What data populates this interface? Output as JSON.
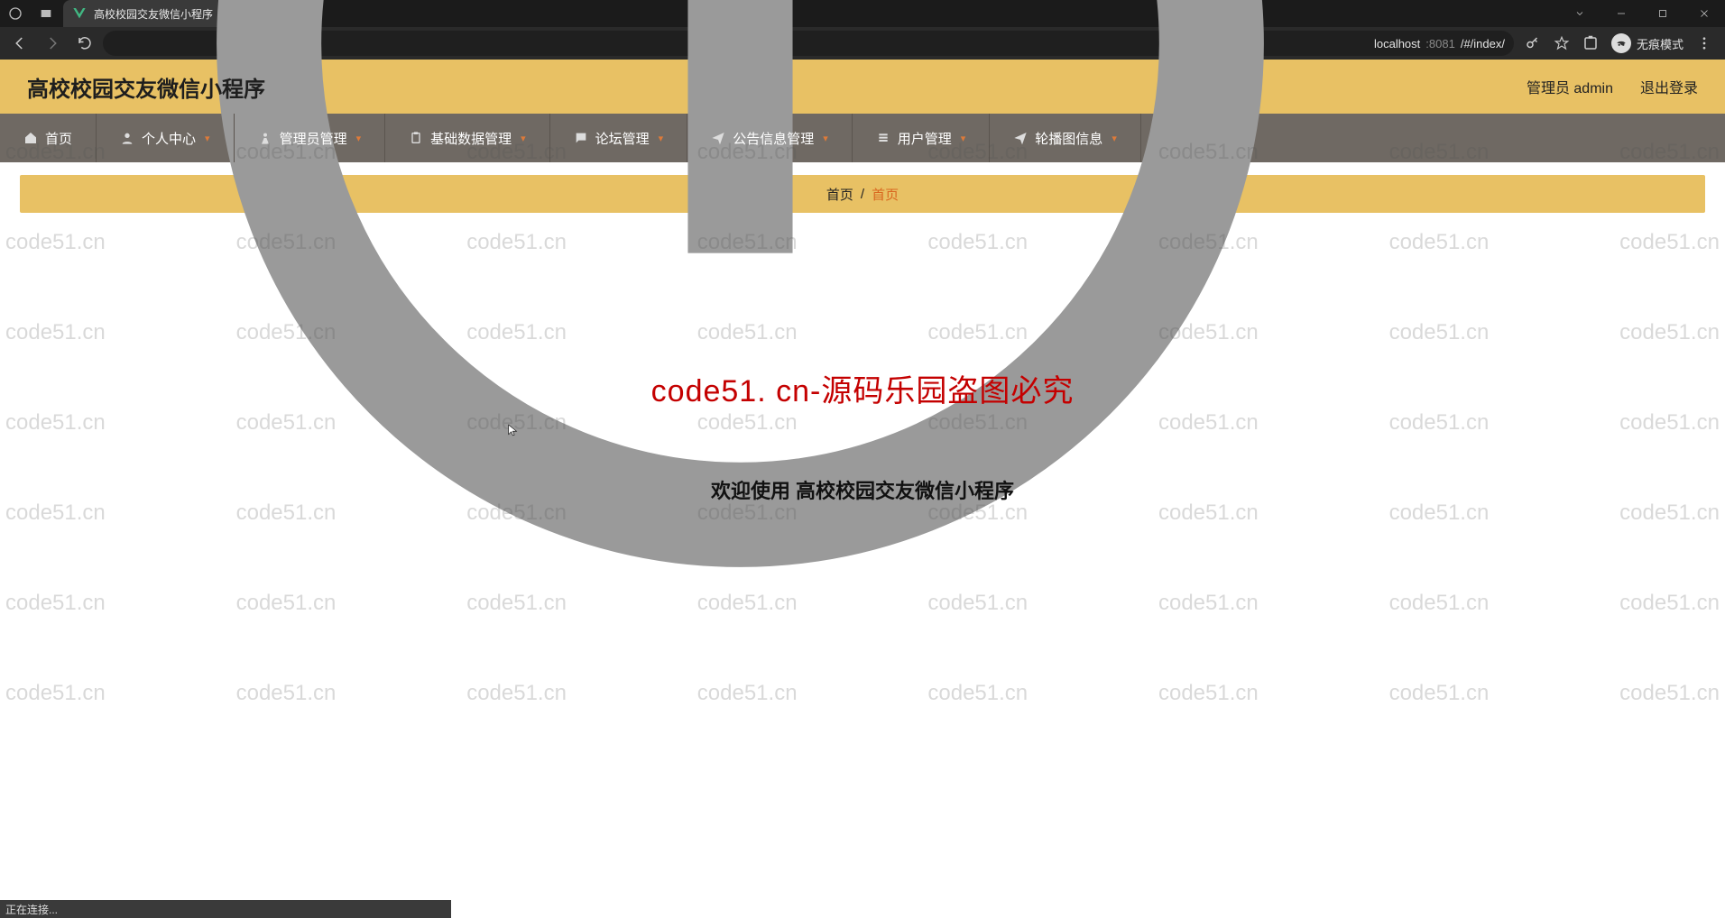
{
  "browser": {
    "tab_title": "高校校园交友微信小程序",
    "url_host": "localhost",
    "url_port": ":8081",
    "url_path": "/#/index/",
    "incognito_label": "无痕模式",
    "status_text": "正在连接..."
  },
  "header": {
    "app_title": "高校校园交友微信小程序",
    "admin_label": "管理员 admin",
    "logout_label": "退出登录"
  },
  "menu": {
    "items": [
      {
        "label": "首页",
        "icon": "home",
        "caret": false
      },
      {
        "label": "个人中心",
        "icon": "user",
        "caret": true
      },
      {
        "label": "管理员管理",
        "icon": "user-tie",
        "caret": true
      },
      {
        "label": "基础数据管理",
        "icon": "clipboard",
        "caret": true
      },
      {
        "label": "论坛管理",
        "icon": "chat",
        "caret": true
      },
      {
        "label": "公告信息管理",
        "icon": "send",
        "caret": true
      },
      {
        "label": "用户管理",
        "icon": "list",
        "caret": true
      },
      {
        "label": "轮播图信息",
        "icon": "send",
        "caret": true
      }
    ]
  },
  "breadcrumb": {
    "root": "首页",
    "current": "首页"
  },
  "main": {
    "watermark_text": "code51.cn",
    "red_banner": "code51. cn-源码乐园盗图必究",
    "welcome": "欢迎使用 高校校园交友微信小程序"
  }
}
